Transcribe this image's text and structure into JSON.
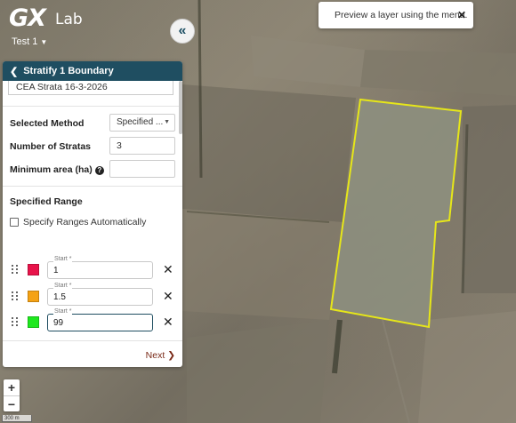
{
  "app": {
    "logo_main": "GX",
    "logo_sub": "Lab",
    "project": "Test 1"
  },
  "toast": {
    "message": "Preview a layer using the menu."
  },
  "panel": {
    "title": "Stratify 1 Boundary",
    "name_value": "CEA Strata 16-3-2026",
    "method_label": "Selected Method",
    "method_value": "Specified ...",
    "stratas_label": "Number of Stratas",
    "stratas_value": "3",
    "min_area_label": "Minimum area (ha)",
    "min_area_value": "",
    "range_section": "Specified Range",
    "auto_label": "Specify Ranges Automatically",
    "ranges": [
      {
        "label": "Start *",
        "value": "1",
        "color": "#e8134a"
      },
      {
        "label": "Start *",
        "value": "1.5",
        "color": "#f5a214"
      },
      {
        "label": "Start *",
        "value": "99",
        "color": "#1ee81e"
      }
    ],
    "next_label": "Next"
  },
  "map": {
    "scale_label": "300 m",
    "boundary_color": "#e6e619"
  }
}
